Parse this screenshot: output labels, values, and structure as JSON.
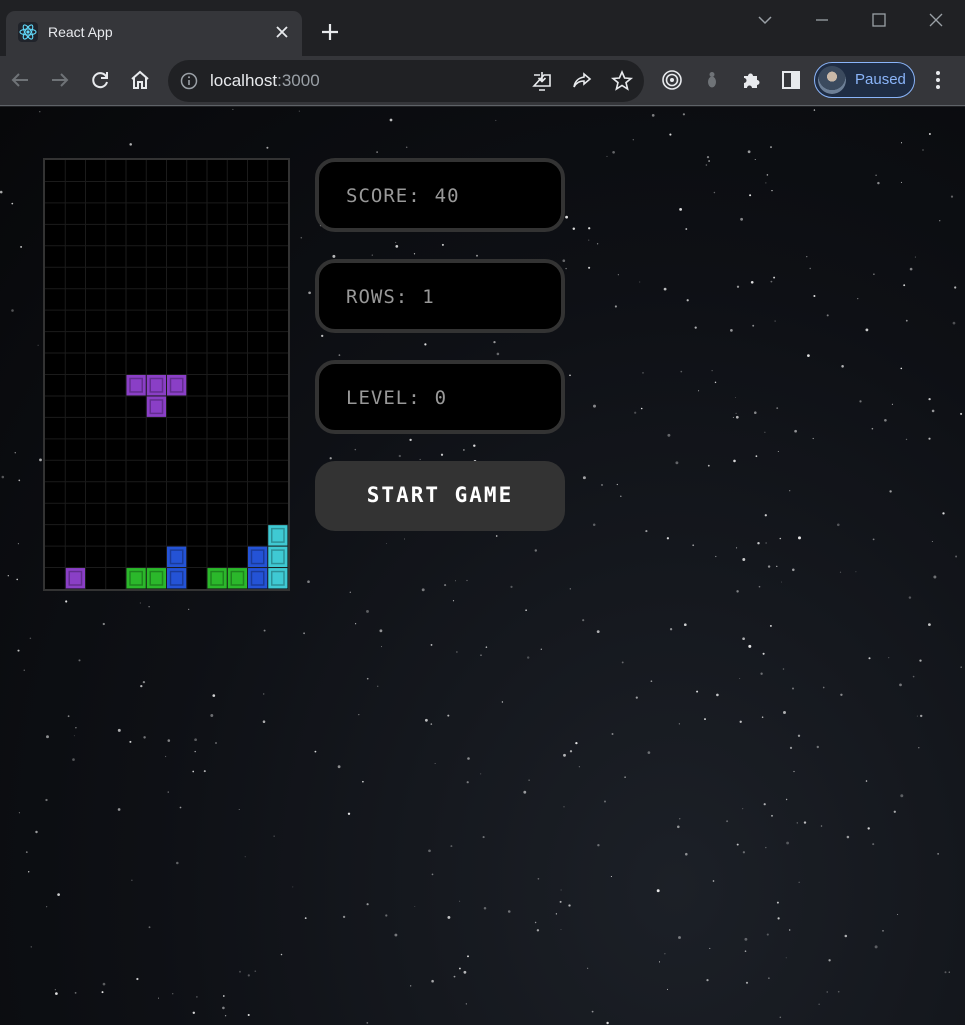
{
  "browser": {
    "tab_title": "React App",
    "url_host": "localhost",
    "url_port": ":3000",
    "profile_label": "Paused"
  },
  "game": {
    "score_label": "SCORE:",
    "score_value": "40",
    "rows_label": "ROWS:",
    "rows_value": "1",
    "level_label": "LEVEL:",
    "level_value": "0",
    "start_label": "START GAME",
    "board": {
      "columns": 12,
      "rows": 20,
      "cells": [
        {
          "col": 4,
          "row": 10,
          "color": "purple"
        },
        {
          "col": 5,
          "row": 10,
          "color": "purple"
        },
        {
          "col": 6,
          "row": 10,
          "color": "purple"
        },
        {
          "col": 5,
          "row": 11,
          "color": "purple"
        },
        {
          "col": 11,
          "row": 17,
          "color": "cyan"
        },
        {
          "col": 6,
          "row": 18,
          "color": "blue"
        },
        {
          "col": 10,
          "row": 18,
          "color": "blue"
        },
        {
          "col": 11,
          "row": 18,
          "color": "cyan"
        },
        {
          "col": 1,
          "row": 19,
          "color": "purple"
        },
        {
          "col": 4,
          "row": 19,
          "color": "green"
        },
        {
          "col": 5,
          "row": 19,
          "color": "green"
        },
        {
          "col": 6,
          "row": 19,
          "color": "blue"
        },
        {
          "col": 8,
          "row": 19,
          "color": "green"
        },
        {
          "col": 9,
          "row": 19,
          "color": "green"
        },
        {
          "col": 10,
          "row": 19,
          "color": "blue"
        },
        {
          "col": 11,
          "row": 19,
          "color": "cyan"
        }
      ]
    },
    "palette": {
      "purple": "#8a3fc6",
      "cyan": "#3fc9d3",
      "blue": "#2453d6",
      "green": "#2bb82b"
    }
  }
}
